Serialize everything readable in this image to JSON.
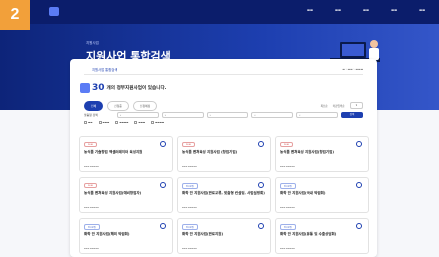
{
  "badge": "2",
  "hero": {
    "kicker": "지원사업",
    "title": "지원사업 통합검색"
  },
  "tabs": [
    "지원사업 통합검색"
  ],
  "count": {
    "number": "30",
    "text": "개의 정부지원사업이 있습니다."
  },
  "filters": [
    "전체",
    "신청중",
    "신청예정"
  ],
  "sort": [
    "최신순",
    "마감임박순"
  ],
  "detail_label": "맞춤형 검색",
  "search_label": "검색",
  "cards": [
    {
      "tag": "D-30",
      "title": "농식품 기술창업 액셀러레이터 육성지원"
    },
    {
      "tag": "D-30",
      "title": "농식품 벤처육성 지원사업 (창업기업)"
    },
    {
      "tag": "D-30",
      "title": "농식품 벤처육성 지원사업(창업기업)"
    },
    {
      "tag": "D-30",
      "title": "농식품 벤처육성 지원사업(예비창업자)"
    },
    {
      "tag": "상시모집",
      "title": "화학 안 지원사업(판로교류, 맞춤형 컨설팅, 사업설명회)"
    },
    {
      "tag": "상시모집",
      "title": "화학 안 지원사업(국내 박람회)"
    },
    {
      "tag": "상시모집",
      "title": "화학 안 지원사업(해외 박람회)"
    },
    {
      "tag": "상시모집",
      "title": "화학 안 지원사업(판로지원)"
    },
    {
      "tag": "상시모집",
      "title": "화학 안 지원사업(유통 및 수출상담회)"
    }
  ]
}
